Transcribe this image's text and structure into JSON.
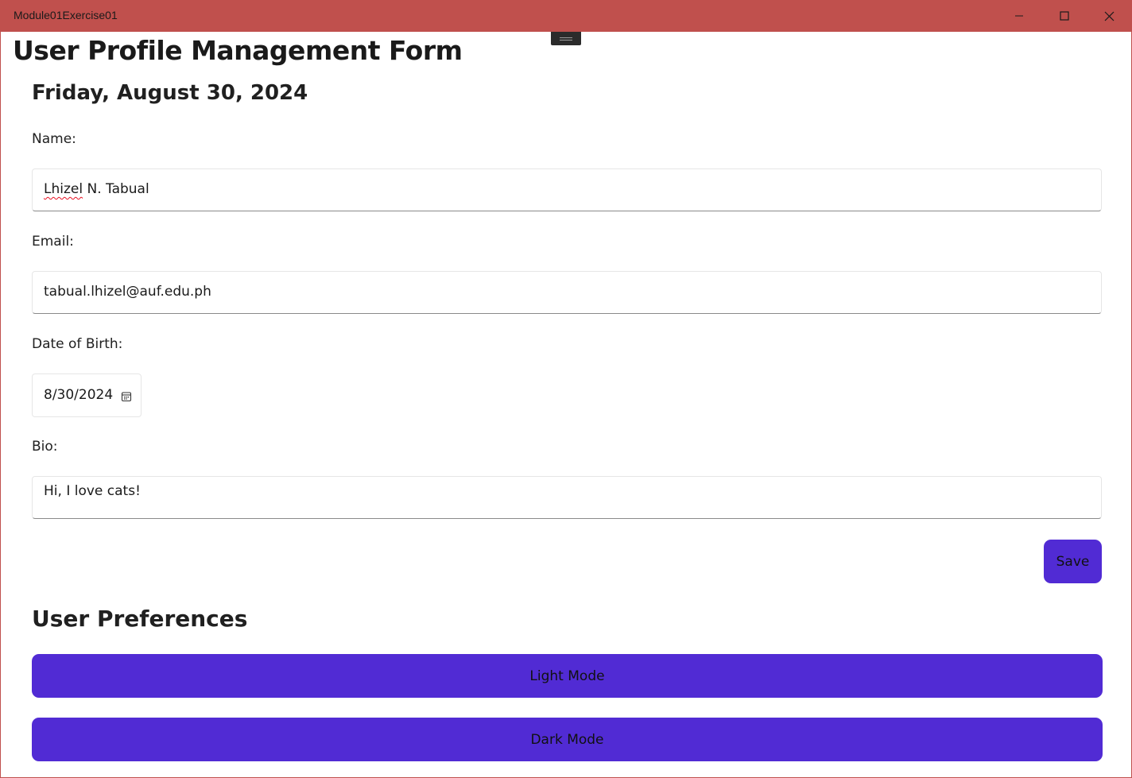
{
  "window": {
    "title": "Module01Exercise01",
    "titlebar_color": "#c0504d",
    "controls": [
      "minimize-icon",
      "maximize-icon",
      "close-icon"
    ]
  },
  "page": {
    "title": "User Profile Management Form",
    "date": "Friday, August 30, 2024"
  },
  "form": {
    "name_label": "Name:",
    "name_first": "Lhizel",
    "name_rest": " N. Tabual",
    "email_label": "Email:",
    "email_value": "tabual.lhizel@auf.edu.ph",
    "dob_label": "Date of Birth:",
    "dob_value": "8/30/2024",
    "bio_label": "Bio:",
    "bio_value": "Hi, I love cats!",
    "save_label": "Save"
  },
  "preferences": {
    "heading": "User Preferences",
    "light_label": "Light Mode",
    "dark_label": "Dark Mode"
  },
  "colors": {
    "accent": "#512bd4"
  }
}
